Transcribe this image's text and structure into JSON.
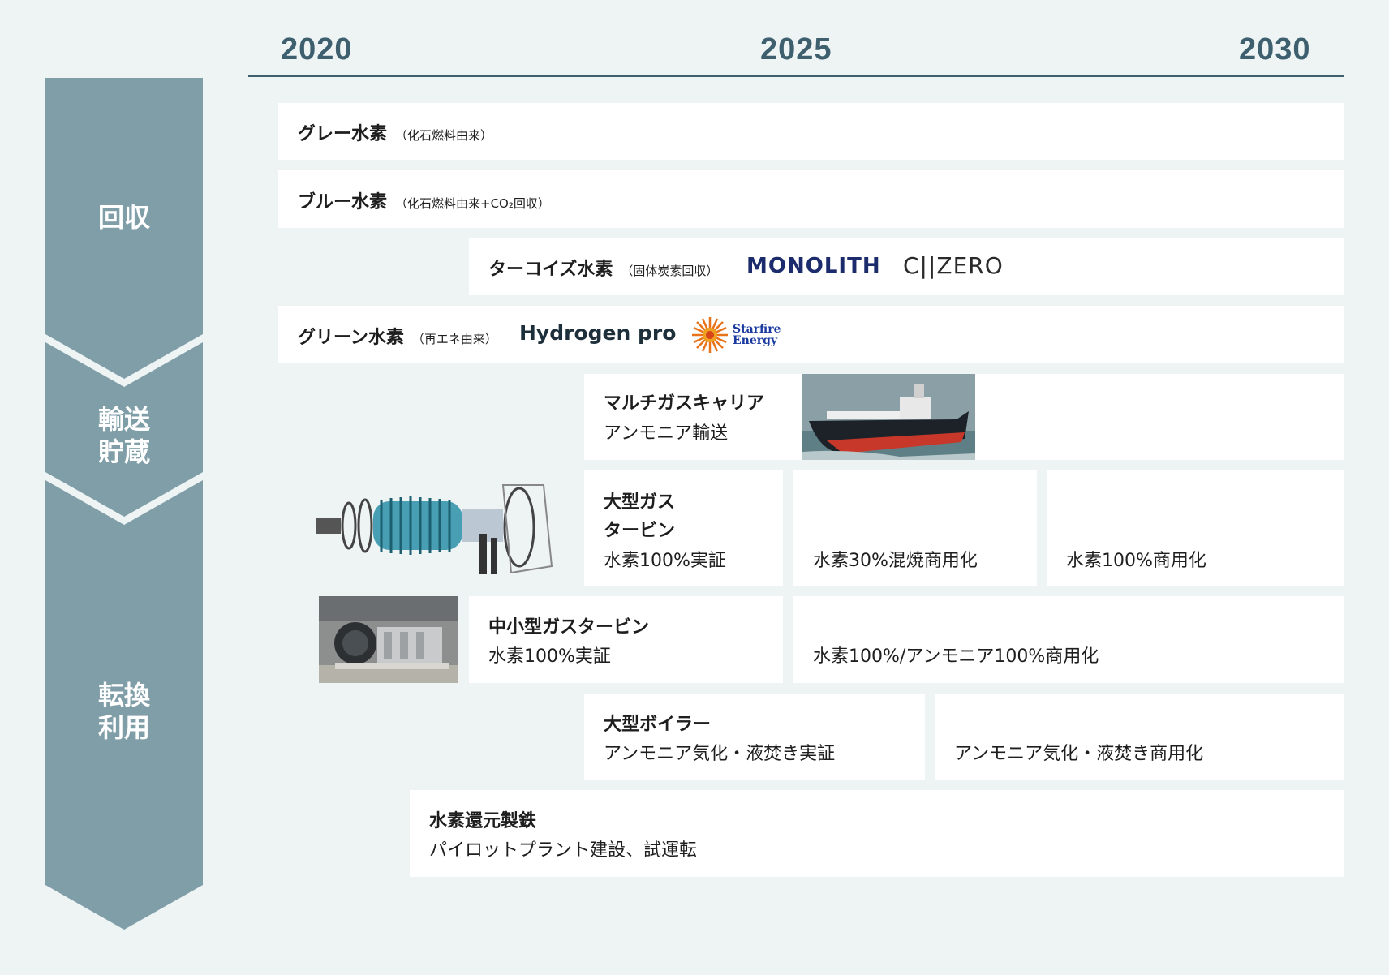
{
  "timeline": {
    "years": [
      "2020",
      "2025",
      "2030"
    ]
  },
  "stages": [
    {
      "label": "回収"
    },
    {
      "label_lines": [
        "輸送",
        "貯蔵"
      ]
    },
    {
      "label_lines": [
        "転換",
        "利用"
      ]
    }
  ],
  "rows": {
    "gray": {
      "title": "グレー水素",
      "note": "（化石燃料由来）"
    },
    "blue": {
      "title": "ブルー水素",
      "note": "（化石燃料由来+CO₂回収）"
    },
    "turquoise": {
      "title": "ターコイズ水素",
      "note": "（固体炭素回収）",
      "logos": [
        "MONOLITH",
        "C||ZERO"
      ]
    },
    "green": {
      "title": "グリーン水素",
      "note": "（再エネ由来）",
      "logos": [
        "Hydrogen pro",
        "Starfire",
        "Energy"
      ]
    },
    "carrier": {
      "title": "マルチガスキャリア",
      "subtitle": "アンモニア輸送"
    },
    "large_turbine": {
      "title_lines": [
        "大型ガス",
        "タービン"
      ],
      "subtitle": "水素100%実証",
      "phase2": "水素30%混焼商用化",
      "phase3": "水素100%商用化"
    },
    "small_turbine": {
      "title": "中小型ガスタービン",
      "subtitle": "水素100%実証",
      "phase2": "水素100%/アンモニア100%商用化"
    },
    "boiler": {
      "title": "大型ボイラー",
      "subtitle": "アンモニア気化・液焚き実証",
      "phase2": "アンモニア気化・液焚き商用化"
    },
    "steel": {
      "title": "水素還元製鉄",
      "subtitle": "パイロットプラント建設、試運転"
    }
  },
  "colors": {
    "stage_arrow": "#7f9ea8",
    "axis": "#3d5f6e",
    "background": "#eef3f4"
  },
  "images": [
    "ship-image",
    "gas-turbine-image",
    "small-turbine-photo"
  ]
}
